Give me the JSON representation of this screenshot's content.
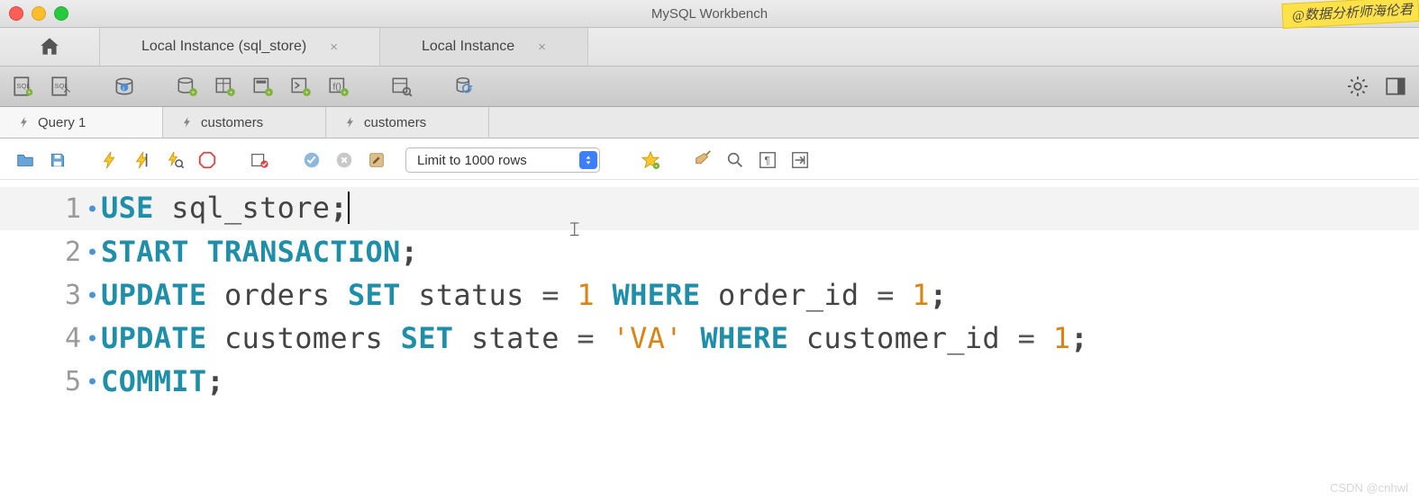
{
  "window": {
    "title": "MySQL Workbench"
  },
  "sticker": "@数据分析师海伦君",
  "conn_tabs": [
    {
      "label": "Local Instance  (sql_store)",
      "active": false
    },
    {
      "label": "Local Instance",
      "active": true
    }
  ],
  "query_tabs": [
    {
      "label": "Query 1",
      "icon": "bolt",
      "active": true
    },
    {
      "label": "customers",
      "icon": "bolt",
      "active": false
    },
    {
      "label": "customers",
      "icon": "bolt",
      "active": false
    }
  ],
  "limit_dropdown": {
    "selected": "Limit to 1000 rows"
  },
  "editor": {
    "highlighted_line": 1,
    "lines": [
      [
        {
          "t": "USE",
          "c": "kw"
        },
        {
          "t": " ",
          "c": "id"
        },
        {
          "t": "sql_store",
          "c": "id"
        },
        {
          "t": ";",
          "c": "punc"
        }
      ],
      [
        {
          "t": "START",
          "c": "kw"
        },
        {
          "t": " ",
          "c": "id"
        },
        {
          "t": "TRANSACTION",
          "c": "kw"
        },
        {
          "t": ";",
          "c": "punc"
        }
      ],
      [
        {
          "t": "UPDATE",
          "c": "kw"
        },
        {
          "t": " ",
          "c": "id"
        },
        {
          "t": "orders",
          "c": "id"
        },
        {
          "t": " ",
          "c": "id"
        },
        {
          "t": "SET",
          "c": "kw"
        },
        {
          "t": " ",
          "c": "id"
        },
        {
          "t": "status",
          "c": "id"
        },
        {
          "t": " ",
          "c": "id"
        },
        {
          "t": "=",
          "c": "op"
        },
        {
          "t": " ",
          "c": "id"
        },
        {
          "t": "1",
          "c": "num"
        },
        {
          "t": " ",
          "c": "id"
        },
        {
          "t": "WHERE",
          "c": "kw"
        },
        {
          "t": " ",
          "c": "id"
        },
        {
          "t": "order_id",
          "c": "id"
        },
        {
          "t": " ",
          "c": "id"
        },
        {
          "t": "=",
          "c": "op"
        },
        {
          "t": " ",
          "c": "id"
        },
        {
          "t": "1",
          "c": "num"
        },
        {
          "t": ";",
          "c": "punc"
        }
      ],
      [
        {
          "t": "UPDATE",
          "c": "kw"
        },
        {
          "t": " ",
          "c": "id"
        },
        {
          "t": "customers",
          "c": "id"
        },
        {
          "t": " ",
          "c": "id"
        },
        {
          "t": "SET",
          "c": "kw"
        },
        {
          "t": " ",
          "c": "id"
        },
        {
          "t": "state",
          "c": "id"
        },
        {
          "t": " ",
          "c": "id"
        },
        {
          "t": "=",
          "c": "op"
        },
        {
          "t": " ",
          "c": "id"
        },
        {
          "t": "'VA'",
          "c": "str"
        },
        {
          "t": " ",
          "c": "id"
        },
        {
          "t": "WHERE",
          "c": "kw"
        },
        {
          "t": " ",
          "c": "id"
        },
        {
          "t": "customer_id",
          "c": "id"
        },
        {
          "t": " ",
          "c": "id"
        },
        {
          "t": "=",
          "c": "op"
        },
        {
          "t": " ",
          "c": "id"
        },
        {
          "t": "1",
          "c": "num"
        },
        {
          "t": ";",
          "c": "punc"
        }
      ],
      [
        {
          "t": "COMMIT",
          "c": "kw"
        },
        {
          "t": ";",
          "c": "punc"
        }
      ]
    ]
  },
  "watermark": "CSDN @cnhwl"
}
